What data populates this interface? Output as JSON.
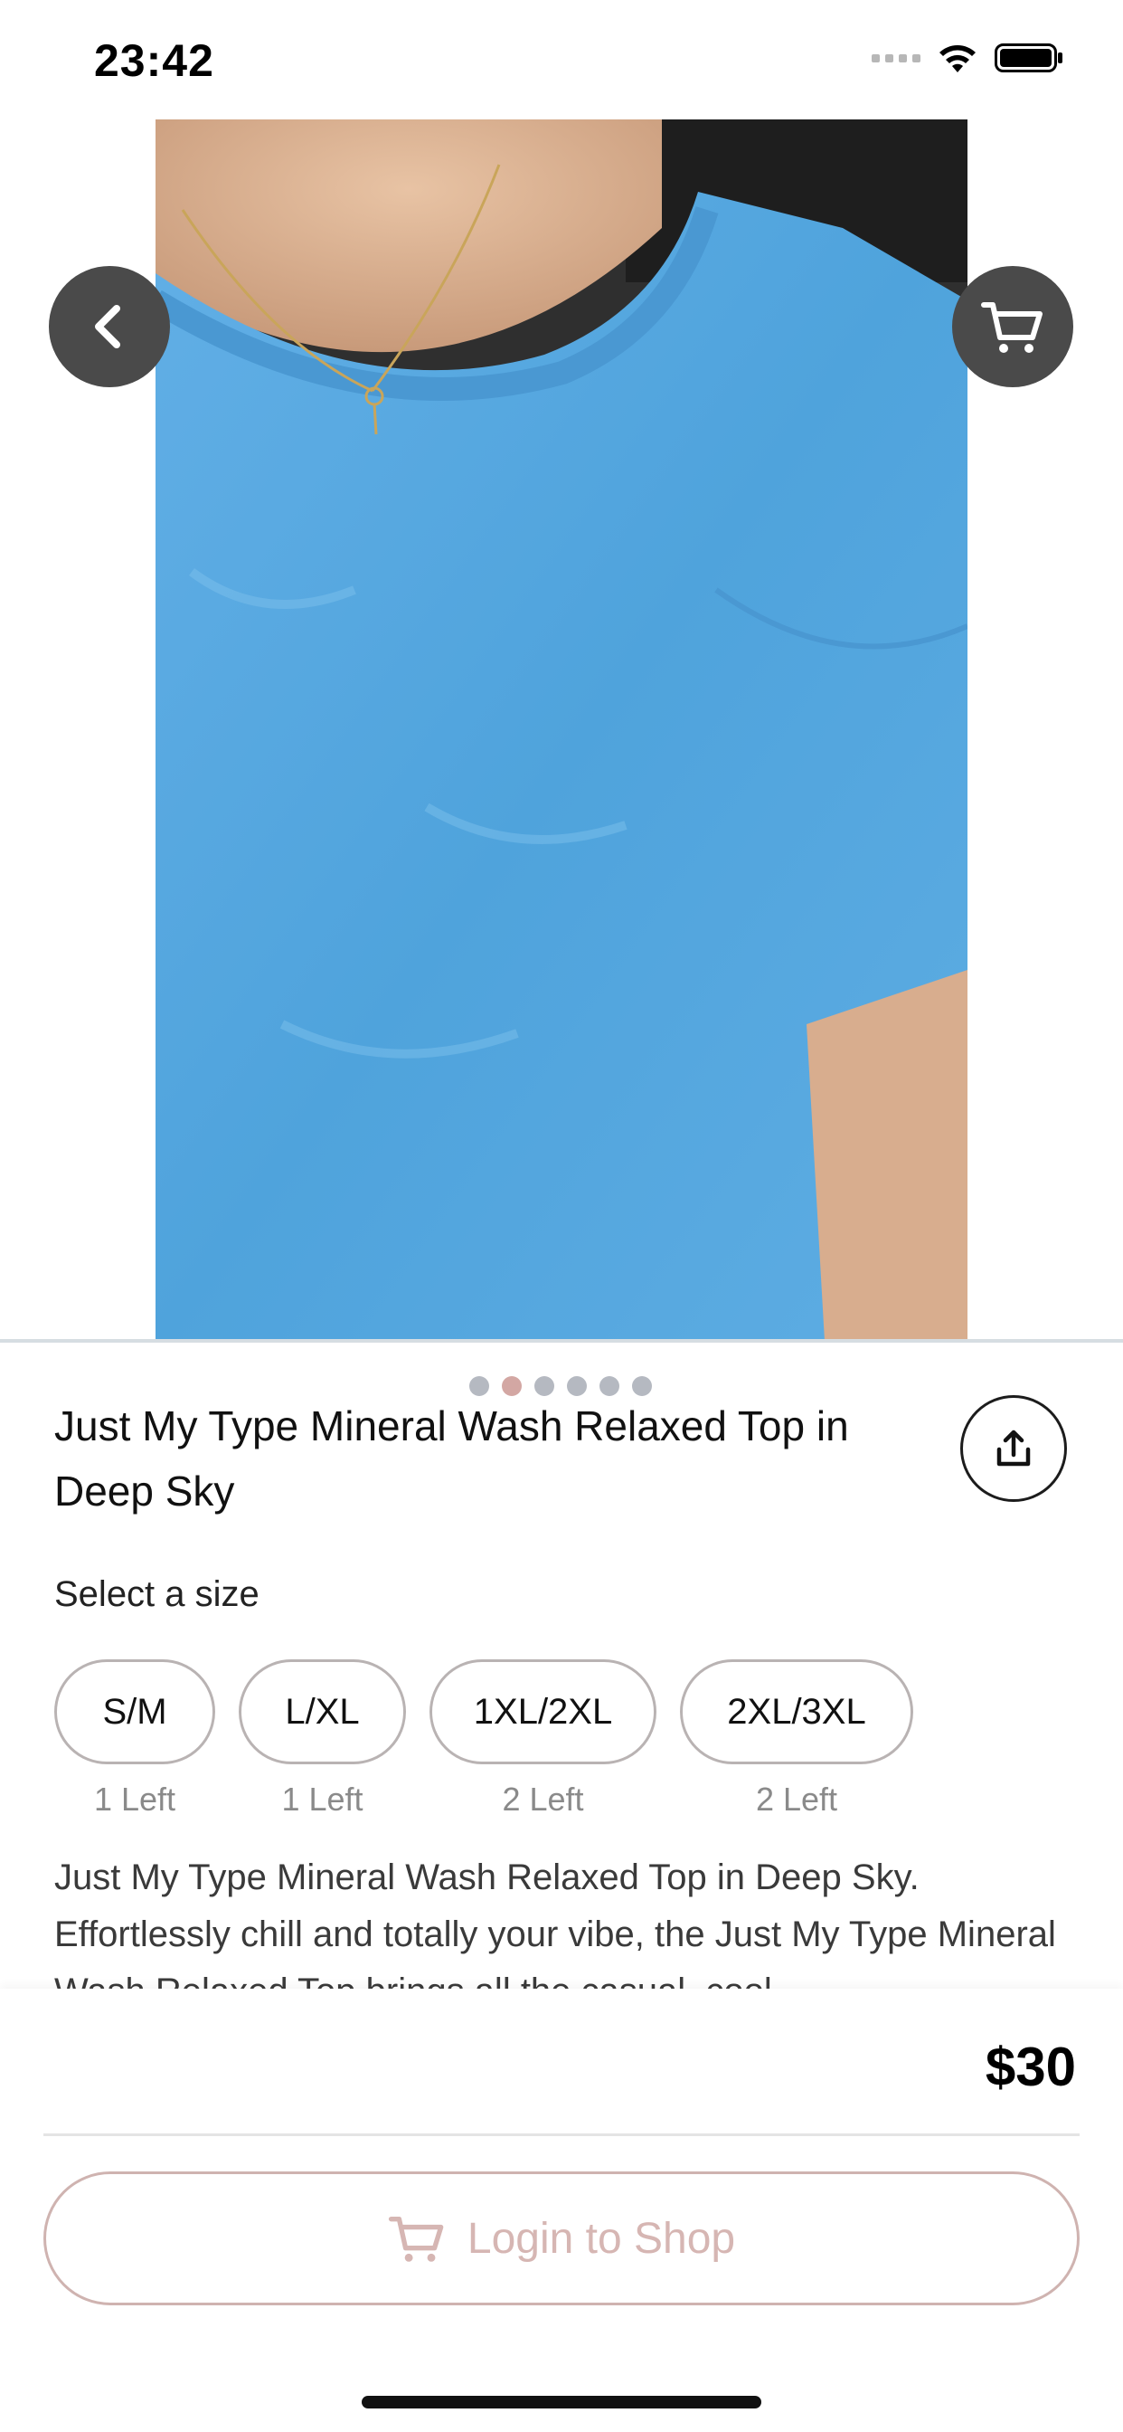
{
  "status_bar": {
    "time": "23:42",
    "icons": [
      "cellular-signal-icon",
      "wifi-icon",
      "battery-icon"
    ]
  },
  "header": {
    "back_icon": "chevron-left-icon",
    "cart_icon": "cart-icon"
  },
  "gallery": {
    "image_count": 6,
    "active_index": 1,
    "active_dot_color": "#d3a7a3",
    "inactive_dot_color": "#b5b9c1"
  },
  "product": {
    "title": "Just My Type Mineral Wash Relaxed Top in Deep Sky",
    "share_icon": "share-icon",
    "size_prompt": "Select a size",
    "sizes": [
      {
        "label": "S/M",
        "stock": "1 Left"
      },
      {
        "label": "L/XL",
        "stock": "1 Left"
      },
      {
        "label": "1XL/2XL",
        "stock": "2 Left"
      },
      {
        "label": "2XL/3XL",
        "stock": "2 Left"
      }
    ],
    "description": "Just My Type Mineral Wash Relaxed Top in Deep Sky. Effortlessly chill and totally your vibe, the Just My Type Mineral Wash Relaxed Top brings all the casual, cool"
  },
  "footer": {
    "price": "$30",
    "login_button": "Login to Shop",
    "accent_color": "#d6b6b3"
  }
}
